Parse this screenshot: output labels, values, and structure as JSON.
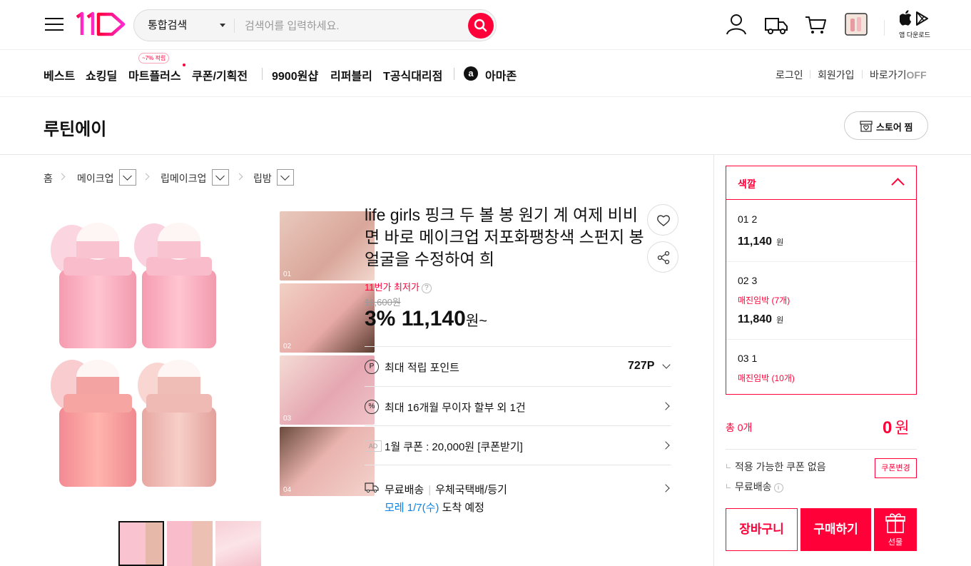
{
  "header": {
    "logo_text": "11",
    "search": {
      "scope_label": "통합검색",
      "placeholder": "검색어를 입력하세요."
    },
    "app_download_label": "앱 다운로드"
  },
  "nav": {
    "items": [
      "베스트",
      "쇼킹딜",
      "마트플러스",
      "쿠폰/기획전",
      "9900원샵",
      "리퍼블리",
      "T공식대리점",
      "아마존"
    ],
    "promo_badge": "~7% 적립",
    "amazon_logo": "a",
    "util": {
      "login": "로그인",
      "signup": "회원가입",
      "shortcut": "바로가기",
      "shortcut_state": "OFF"
    }
  },
  "store": {
    "name": "루틴에이",
    "follow_label": "스토어 찜"
  },
  "breadcrumb": [
    "홈",
    "메이크업",
    "립메이크업",
    "립밤"
  ],
  "gallery": {
    "face_labels": [
      "01",
      "02",
      "03",
      "04"
    ],
    "selected_thumb": 0
  },
  "product": {
    "title": "life girls 핑크 두 볼 봉 원기 계 여제 비비면 바로 메이크업 저포화팽창색 스펀지 봉 얼굴을 수정하여 희",
    "lowest_label": "11번가 최저가",
    "original_price": "11,600원",
    "discount": "3%",
    "sale_price": "11,140",
    "sale_unit": "원~",
    "benefits": {
      "points_label": "최대 적립 포인트",
      "points_value": "727P",
      "installment_label": "최대 16개월 무이자 할부 외 1건",
      "ad_tag": "AD",
      "coupon_label": "1월 쿠폰 : 20,000원 [쿠폰받기]",
      "shipping_label": "무료배송",
      "shipping_method": "우체국택배/등기",
      "arrival_date": "모레 1/7(수)",
      "arrival_suffix": "도착 예정"
    }
  },
  "options": {
    "header_label": "색깔",
    "items": [
      {
        "name": "01 2",
        "status": "",
        "price": "11,140",
        "unit": "원"
      },
      {
        "name": "02 3",
        "status": "매진임박 (7개)",
        "price": "11,840",
        "unit": "원"
      },
      {
        "name": "03 1",
        "status": "매진임박 (10개)",
        "price": "",
        "unit": ""
      }
    ]
  },
  "order": {
    "total_label": "총 0개",
    "total_value": "0",
    "total_unit": "원",
    "coupon_status": "적용 가능한 쿠폰 없음",
    "coupon_change": "쿠폰변경",
    "shipping": "무료배송",
    "cart_label": "장바구니",
    "buy_label": "구매하기",
    "gift_label": "선물"
  },
  "colors": {
    "accent": "#ff0038",
    "link_blue": "#0b83e6"
  }
}
